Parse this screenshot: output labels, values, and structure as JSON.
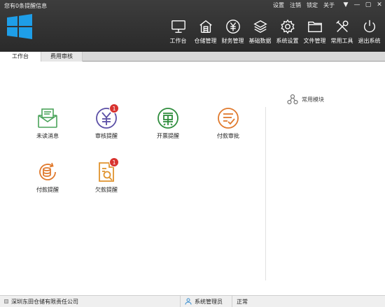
{
  "header": {
    "info_text": "您有0条提醒信息",
    "links": [
      "设置",
      "注销",
      "锁定",
      "关于"
    ],
    "window_controls": [
      "▼",
      "—",
      "▢",
      "✕"
    ]
  },
  "nav": [
    {
      "label": "工作台",
      "icon": "monitor-icon"
    },
    {
      "label": "仓储管理",
      "icon": "warehouse-icon"
    },
    {
      "label": "财务管理",
      "icon": "yen-icon"
    },
    {
      "label": "基础数据",
      "icon": "layers-icon"
    },
    {
      "label": "系统设置",
      "icon": "gear-icon"
    },
    {
      "label": "文件管理",
      "icon": "folder-icon"
    },
    {
      "label": "常用工具",
      "icon": "tools-icon"
    },
    {
      "label": "退出系统",
      "icon": "power-icon"
    }
  ],
  "tabs": [
    {
      "label": "工作台",
      "active": true
    },
    {
      "label": "费用审核",
      "active": false
    }
  ],
  "tiles": [
    {
      "label": "未读消息",
      "icon": "mail-icon",
      "color": "#4aa35a",
      "badge": ""
    },
    {
      "label": "审核提醒",
      "icon": "yen-circle-icon",
      "color": "#5b4fa6",
      "badge": "1"
    },
    {
      "label": "开票提醒",
      "icon": "invoice-icon",
      "color": "#2f8d3d",
      "badge": ""
    },
    {
      "label": "付款审批",
      "icon": "approval-list-icon",
      "color": "#e07a2e",
      "badge": ""
    },
    {
      "label": "付款提醒",
      "icon": "coins-icon",
      "color": "#e07a2e",
      "badge": ""
    },
    {
      "label": "欠款提醒",
      "icon": "debt-search-icon",
      "color": "#e0932e",
      "badge": "1"
    }
  ],
  "favorites": {
    "label": "常用模块",
    "icon": "modules-icon"
  },
  "status": {
    "company": "深圳东田仓储有限责任公司",
    "user": "系统管理员",
    "state": "正常"
  }
}
